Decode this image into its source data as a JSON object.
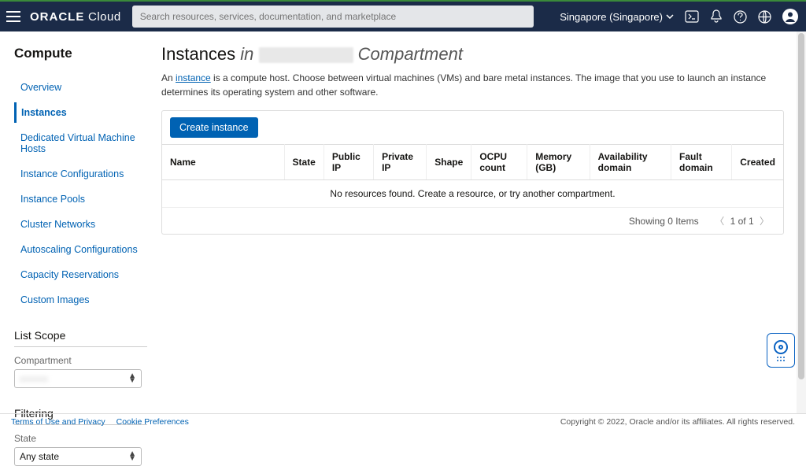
{
  "header": {
    "brand_bold": "ORACLE",
    "brand_light": "Cloud",
    "search_placeholder": "Search resources, services, documentation, and marketplace",
    "region": "Singapore (Singapore)"
  },
  "sidebar": {
    "title": "Compute",
    "items": [
      {
        "label": "Overview"
      },
      {
        "label": "Instances"
      },
      {
        "label": "Dedicated Virtual Machine Hosts"
      },
      {
        "label": "Instance Configurations"
      },
      {
        "label": "Instance Pools"
      },
      {
        "label": "Cluster Networks"
      },
      {
        "label": "Autoscaling Configurations"
      },
      {
        "label": "Capacity Reservations"
      },
      {
        "label": "Custom Images"
      }
    ],
    "list_scope_title": "List Scope",
    "compartment_label": "Compartment",
    "filtering_title": "Filtering",
    "state_label": "State",
    "state_value": "Any state"
  },
  "page": {
    "title_main": "Instances",
    "title_in": "in",
    "title_compartment": "Compartment",
    "desc_prefix": "An ",
    "desc_link": "instance",
    "desc_suffix": " is a compute host. Choose between virtual machines (VMs) and bare metal instances. The image that you use to launch an instance determines its operating system and other software.",
    "create_btn": "Create instance",
    "columns": [
      "Name",
      "State",
      "Public IP",
      "Private IP",
      "Shape",
      "OCPU count",
      "Memory (GB)",
      "Availability domain",
      "Fault domain",
      "Created"
    ],
    "empty_msg": "No resources found. Create a resource, or try another compartment.",
    "pager_text": "Showing 0 Items",
    "pager_range": "1 of 1"
  },
  "footer": {
    "link1": "Terms of Use and Privacy",
    "link2": "Cookie Preferences",
    "copyright": "Copyright © 2022, Oracle and/or its affiliates. All rights reserved."
  }
}
